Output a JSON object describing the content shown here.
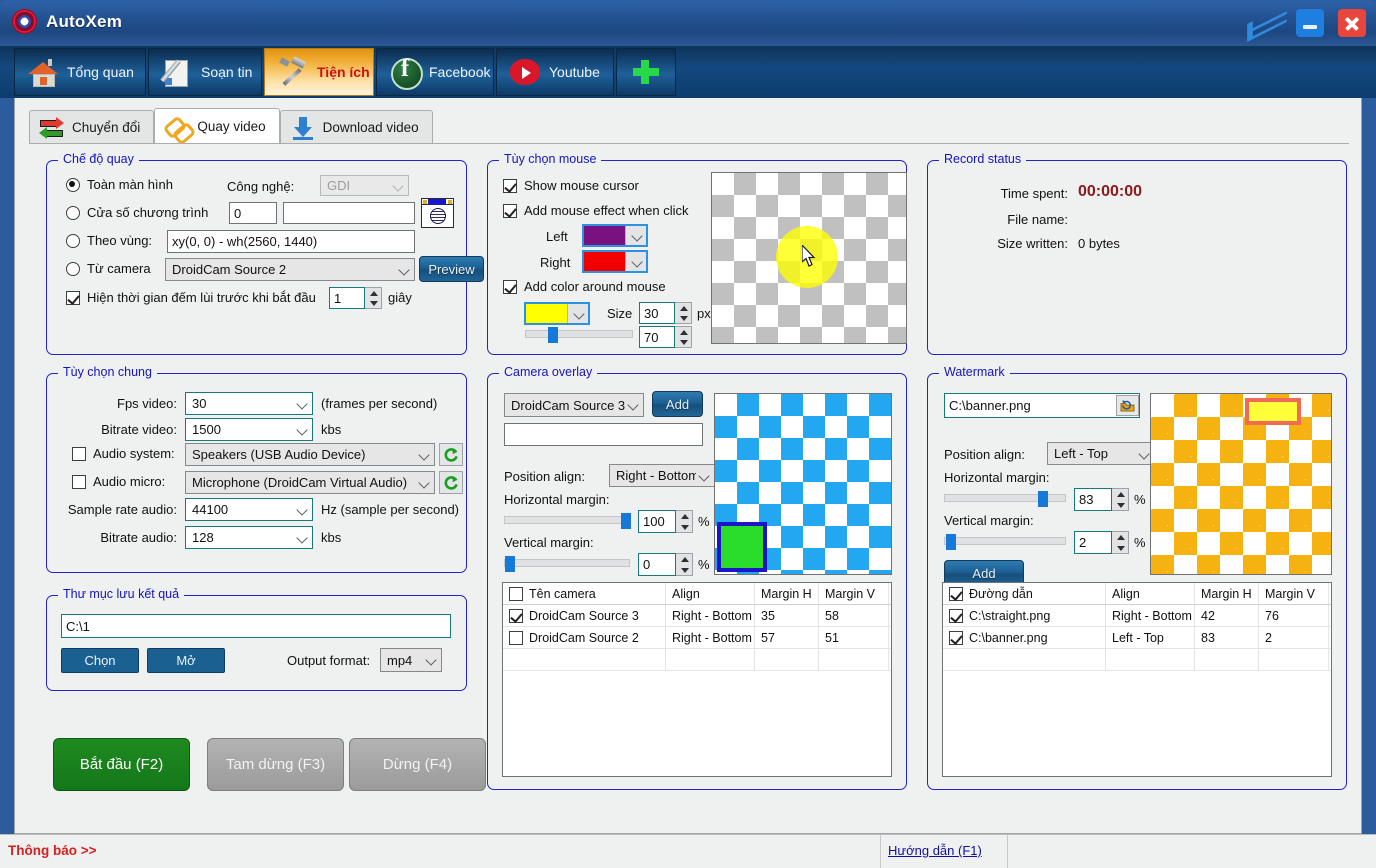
{
  "window": {
    "app_title": "AutoXem",
    "logo_icon": "target-logo-icon",
    "collapse_icon": "double-chevron-down-icon",
    "minimize_icon": "minimize-icon",
    "close_icon": "close-icon",
    "border_color": "#2b5c9e"
  },
  "main_tabs": [
    {
      "label": "Tổng quan",
      "icon": "home-icon",
      "active": false
    },
    {
      "label": "Soạn tin",
      "icon": "pencil-paper-icon",
      "active": false
    },
    {
      "label": "Tiện ích",
      "icon": "hammer-tools-icon",
      "active": true
    },
    {
      "label": "Facebook",
      "icon": "facebook-icon",
      "active": false
    },
    {
      "label": "Youtube",
      "icon": "youtube-icon",
      "active": false
    },
    {
      "label": "",
      "icon": "plus-icon",
      "active": false
    }
  ],
  "sub_tabs": [
    {
      "label": "Chuyển đổi",
      "icon": "convert-arrows-icon",
      "active": false
    },
    {
      "label": "Quay video",
      "icon": "chain-link-icon",
      "active": true
    },
    {
      "label": "Download video",
      "icon": "download-arrow-icon",
      "active": false
    }
  ],
  "record_mode": {
    "title": "Chế độ quay",
    "option_fullscreen": "Toàn màn hình",
    "option_window": "Cửa số chương trình",
    "option_region": "Theo vùng:",
    "option_camera": "Từ camera",
    "selected_option": "fullscreen",
    "tech_label": "Công nghệ:",
    "tech_value": "GDI",
    "window_index_value": "0",
    "window_name_value": "",
    "region_value": "xy(0, 0) - wh(2560, 1440)",
    "camera_value": "DroidCam Source 2",
    "preview_button": "Preview",
    "picker_icon": "window-picker-icon",
    "countdown_label": "Hiện thời gian đếm lùi trước khi bắt đầu",
    "countdown_checked": true,
    "countdown_value": "1",
    "countdown_unit": "giây"
  },
  "mouse_options": {
    "title": "Tùy chọn mouse",
    "show_cursor_label": "Show mouse cursor",
    "show_cursor_checked": true,
    "click_effect_label": "Add mouse effect when click",
    "click_effect_checked": true,
    "left_label": "Left",
    "left_color": "#7a1180",
    "right_label": "Right",
    "right_color": "#f20000",
    "around_label": "Add color around mouse",
    "around_checked": true,
    "around_color": "#ffff00",
    "size_label": "Size",
    "size_value": "30",
    "size_unit": "px",
    "opacity_value": "70",
    "slider_percent": 23,
    "preview_icon": "mouse-cursor-preview"
  },
  "record_status": {
    "title": "Record status",
    "time_spent_label": "Time spent:",
    "time_spent_value": "00:00:00",
    "time_spent_color": "#8b1a1a",
    "file_name_label": "File name:",
    "file_name_value": "",
    "size_written_label": "Size written:",
    "size_written_value": "0 bytes"
  },
  "general_options": {
    "title": "Tùy chọn chung",
    "fps_label": "Fps video:",
    "fps_value": "30",
    "fps_note": "(frames per second)",
    "bitrate_video_label": "Bitrate video:",
    "bitrate_video_value": "1500",
    "bitrate_video_unit": "kbs",
    "audio_system_label": "Audio system:",
    "audio_system_checked": false,
    "audio_system_value": "Speakers (USB Audio Device)",
    "audio_micro_label": "Audio micro:",
    "audio_micro_checked": false,
    "audio_micro_value": "Microphone (DroidCam Virtual Audio)",
    "sample_rate_label": "Sample rate audio:",
    "sample_rate_value": "44100",
    "sample_rate_unit": "Hz (sample per second)",
    "bitrate_audio_label": "Bitrate audio:",
    "bitrate_audio_value": "128",
    "bitrate_audio_unit": "kbs",
    "refresh_icon": "refresh-icon"
  },
  "output_folder": {
    "title": "Thư mục lưu kết quả",
    "path_value": "C:\\1",
    "choose_button": "Chọn",
    "open_button": "Mở",
    "format_label": "Output format:",
    "format_value": "mp4"
  },
  "transport": {
    "start_button": "Bắt đầu (F2)",
    "pause_button": "Tam dừng (F3)",
    "stop_button": "Dừng (F4)"
  },
  "camera_overlay": {
    "title": "Camera overlay",
    "source_value": "DroidCam Source 3",
    "add_button": "Add",
    "name_value": "",
    "position_label": "Position align:",
    "position_value": "Right - Bottom",
    "h_margin_label": "Horizontal margin:",
    "h_margin_value": "100",
    "h_margin_percent": 100,
    "v_margin_label": "Vertical margin:",
    "v_margin_value": "0",
    "v_margin_percent": 0,
    "percent_unit": "%",
    "preview_checker_color": "#22a7f0",
    "preview_box_color": "#2bdd2b",
    "preview_box_border": "#1d13c9",
    "table": {
      "headers": [
        "Tên camera",
        "Align",
        "Margin H",
        "Margin V"
      ],
      "header_checked": false,
      "rows": [
        {
          "checked": true,
          "name": "DroidCam Source 3",
          "align": "Right - Bottom",
          "margin_h": "35",
          "margin_v": "58"
        },
        {
          "checked": false,
          "name": "DroidCam Source 2",
          "align": "Right - Bottom",
          "margin_h": "57",
          "margin_v": "51"
        }
      ]
    }
  },
  "watermark": {
    "title": "Watermark",
    "path_value": "C:\\banner.png",
    "browse_icon": "folder-browse-icon",
    "position_label": "Position align:",
    "position_value": "Left - Top",
    "h_margin_label": "Horizontal margin:",
    "h_margin_value": "83",
    "h_margin_percent": 78,
    "v_margin_label": "Vertical margin:",
    "v_margin_value": "2",
    "v_margin_percent": 2,
    "percent_unit": "%",
    "add_button": "Add",
    "preview_checker_color": "#f5b210",
    "preview_banner_fill": "#ffff3a",
    "preview_banner_border": "#f26a55",
    "table": {
      "headers": [
        "Đường dẫn",
        "Align",
        "Margin H",
        "Margin V"
      ],
      "header_checked": true,
      "rows": [
        {
          "checked": true,
          "name": "C:\\straight.png",
          "align": "Right - Bottom",
          "margin_h": "42",
          "margin_v": "76"
        },
        {
          "checked": true,
          "name": "C:\\banner.png",
          "align": "Left - Top",
          "margin_h": "83",
          "margin_v": "2"
        }
      ]
    }
  },
  "statusbar": {
    "notice": "Thông báo >>",
    "guide": "Hướng dẫn (F1)"
  }
}
